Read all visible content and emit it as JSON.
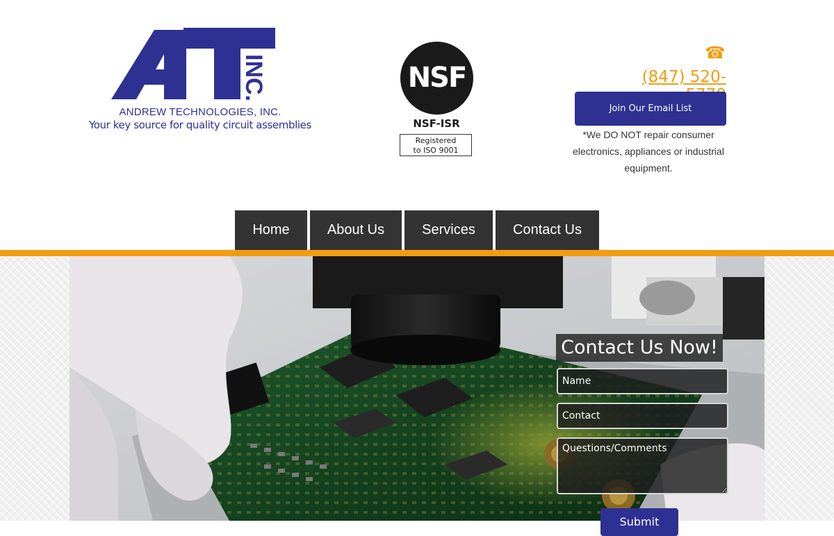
{
  "header": {
    "logo": {
      "letters": "AT",
      "inc": "INC.",
      "company_name": "ANDREW TECHNOLOGIES, INC.",
      "tagline": "Your key source for quality circuit assemblies"
    },
    "certification": {
      "logo_text": "NSF",
      "reg_mark": "®",
      "program": "NSF-ISR",
      "registration_line1": "Registered",
      "registration_line2": "to ISO 9001"
    },
    "phone": {
      "icon": "phone-icon",
      "number": "(847) 520-5770"
    },
    "email_button_label": "Join Our Email List",
    "disclaimer": "*We DO NOT repair consumer electronics, appliances or industrial equipment."
  },
  "nav": {
    "items": [
      {
        "label": "Home"
      },
      {
        "label": "About Us"
      },
      {
        "label": "Services"
      },
      {
        "label": "Contact Us"
      }
    ]
  },
  "contact_form": {
    "title": "Contact Us Now!",
    "name_placeholder": "Name",
    "contact_placeholder": "Contact",
    "comments_placeholder": "Questions/Comments",
    "submit_label": "Submit"
  },
  "colors": {
    "brand_blue": "#2e3192",
    "accent_orange": "#f39c12",
    "nav_bg": "#333333"
  }
}
